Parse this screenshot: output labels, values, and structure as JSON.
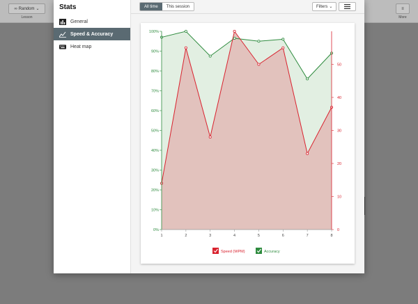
{
  "background": {
    "lesson_button": "Random",
    "lesson_caption": "Lesson",
    "more_caption": "More"
  },
  "dialog": {
    "title": "Stats",
    "sidebar": [
      {
        "label": "General",
        "icon": "bar-chart-icon",
        "active": false
      },
      {
        "label": "Speed & Accuracy",
        "icon": "line-chart-icon",
        "active": true
      },
      {
        "label": "Heat map",
        "icon": "keyboard-icon",
        "active": false
      }
    ],
    "toolbar": {
      "all_time": "All time",
      "this_session": "This session",
      "filters": "Filters"
    }
  },
  "colors": {
    "speed": "#d9222e",
    "accuracy": "#2e8b3e",
    "speed_fill": "#e2c2bd",
    "accuracy_fill": "#e2efe2",
    "active_item": "#5a6a72"
  },
  "chart_data": {
    "type": "area",
    "x": [
      1,
      2,
      3,
      4,
      5,
      6,
      7,
      8
    ],
    "series": [
      {
        "name": "Speed (WPM)",
        "axis": "right",
        "values": [
          14,
          55,
          28,
          60,
          50,
          55,
          23,
          37
        ]
      },
      {
        "name": "Accuracy",
        "axis": "left",
        "values": [
          97,
          100,
          87.5,
          96.5,
          95,
          96,
          76,
          89
        ]
      }
    ],
    "left_axis": {
      "ylim": [
        0,
        100
      ],
      "ticks": [
        "0%",
        "10%",
        "20%",
        "30%",
        "40%",
        "50%",
        "60%",
        "70%",
        "80%",
        "90%",
        "100%"
      ]
    },
    "right_axis": {
      "ylim": [
        0,
        60
      ],
      "ticks": [
        "0",
        "10",
        "20",
        "30",
        "40",
        "50"
      ]
    },
    "x_ticks": [
      "1",
      "2",
      "3",
      "4",
      "5",
      "6",
      "7",
      "8"
    ],
    "legend": {
      "placement": "bottom",
      "items": [
        "Speed (WPM)",
        "Accuracy"
      ]
    }
  }
}
